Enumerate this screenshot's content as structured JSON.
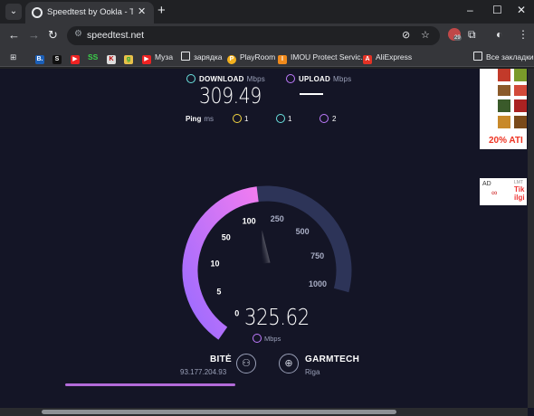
{
  "browser": {
    "tab_title": "Speedtest by Ookla - The Global",
    "url": "speedtest.net",
    "extension_badge": "29",
    "bookmarks": [
      {
        "label": "",
        "icon": "B."
      },
      {
        "label": "",
        "icon": "S"
      },
      {
        "label": "",
        "icon": "▶"
      },
      {
        "label": "SS",
        "icon": ""
      },
      {
        "label": "",
        "icon": "K"
      },
      {
        "label": "",
        "icon": "g"
      },
      {
        "label": "Музa",
        "icon": "▶"
      },
      {
        "label": "зарядка",
        "icon": "folder"
      },
      {
        "label": "PlayRoom",
        "icon": "P"
      },
      {
        "label": "IMOU Protect Servic...",
        "icon": "I"
      },
      {
        "label": "AliExpress",
        "icon": "A"
      }
    ],
    "all_bookmarks": "Все закладки"
  },
  "results": {
    "download_label": "DOWNLOAD",
    "download_unit": "Mbps",
    "download_value": "309.49",
    "upload_label": "UPLOAD",
    "upload_unit": "Mbps",
    "ping_label": "Ping",
    "ping_unit": "ms",
    "ping_idle": "1",
    "ping_download": "1",
    "ping_upload": "2"
  },
  "gauge": {
    "ticks": [
      "0",
      "5",
      "10",
      "50",
      "100",
      "250",
      "500",
      "750",
      "1000"
    ],
    "current_value": "325.62",
    "current_unit": "Mbps",
    "fraction": 0.552
  },
  "provider": {
    "name": "BITĖ",
    "ip": "93.177.204.93"
  },
  "server": {
    "name": "GARMTECH",
    "city": "Riga"
  },
  "ads": {
    "ad1_text": "20% ATI",
    "ad2_label": "AD",
    "ad2_text": "Tik ilgi",
    "ad2_brand": "LMT"
  },
  "colors": {
    "accent_pink": "#e879f9",
    "accent_purple": "#9b6bff",
    "track": "#2d3458",
    "cyan": "#6be3e0"
  }
}
